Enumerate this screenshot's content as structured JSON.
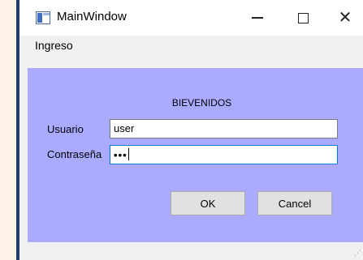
{
  "window": {
    "title": "MainWindow",
    "minimize_icon": "minimize-icon",
    "maximize_icon": "maximize-icon",
    "close_icon": "close-icon",
    "close_glyph": "✕"
  },
  "menubar": {
    "items": [
      {
        "label": "Ingreso"
      }
    ]
  },
  "login": {
    "heading": "BIEVENIDOS",
    "user_label": "Usuario",
    "user_value": "user",
    "password_label": "Contraseña",
    "password_value": "•••",
    "ok_label": "OK",
    "cancel_label": "Cancel",
    "background_color": "#aaaaff",
    "focus_color": "#0078d7"
  },
  "statusbar": {
    "grip_glyph": "⋰"
  }
}
